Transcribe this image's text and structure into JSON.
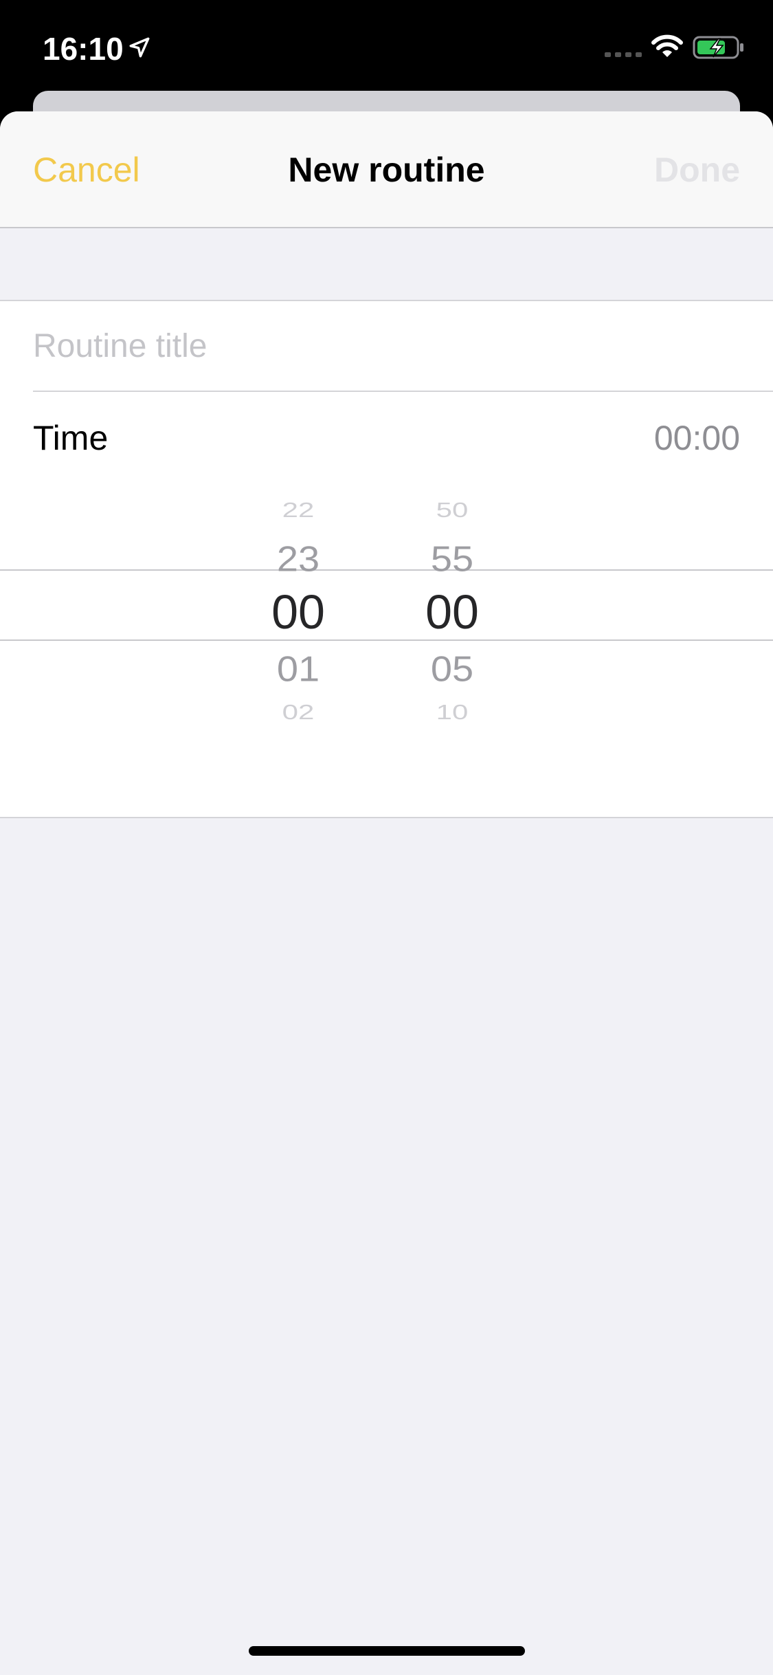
{
  "status_bar": {
    "time": "16:10",
    "icons": [
      "location-arrow-icon",
      "cellular-signal-icon",
      "wifi-icon",
      "battery-charging-icon"
    ],
    "battery_color": "#34c759"
  },
  "nav": {
    "cancel_label": "Cancel",
    "title": "New routine",
    "done_label": "Done",
    "accent_color": "#f2c94c",
    "done_disabled_color": "#e3e3e6"
  },
  "form": {
    "title_placeholder": "Routine title",
    "title_value": "",
    "time_label": "Time",
    "time_value": "00:00"
  },
  "picker": {
    "hours": {
      "far_above": "22",
      "above": "23",
      "selected": "00",
      "below": "01",
      "far_below": "02"
    },
    "minutes": {
      "far_above": "50",
      "above": "55",
      "selected": "00",
      "below": "05",
      "far_below": "10"
    }
  }
}
